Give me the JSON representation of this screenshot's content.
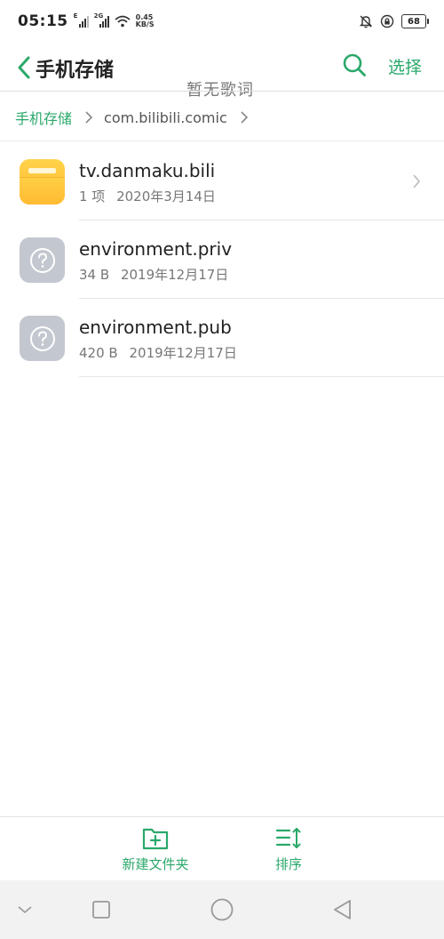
{
  "status_bar": {
    "time": "05:15",
    "signal1_label": "E",
    "signal2_label": "2G",
    "net_speed_value": "0.45",
    "net_speed_unit": "KB/S",
    "battery": "68"
  },
  "header": {
    "title": "手机存储",
    "select_label": "选择",
    "lyric_overlay": "暂无歌词"
  },
  "breadcrumb": {
    "root": "手机存储",
    "current": "com.bilibili.comic"
  },
  "files": [
    {
      "name": "tv.danmaku.bili",
      "size": "1 项",
      "date": "2020年3月14日",
      "type": "folder-icon"
    },
    {
      "name": "environment.priv",
      "size": "34 B",
      "date": "2019年12月17日",
      "type": "unknown-file-icon"
    },
    {
      "name": "environment.pub",
      "size": "420 B",
      "date": "2019年12月17日",
      "type": "unknown-file-icon"
    }
  ],
  "toolbar": {
    "new_folder_label": "新建文件夹",
    "sort_label": "排序"
  },
  "colors": {
    "accent": "#2aa86a",
    "folder": "#ffc23a",
    "unknown_icon": "#c3c7cf"
  }
}
